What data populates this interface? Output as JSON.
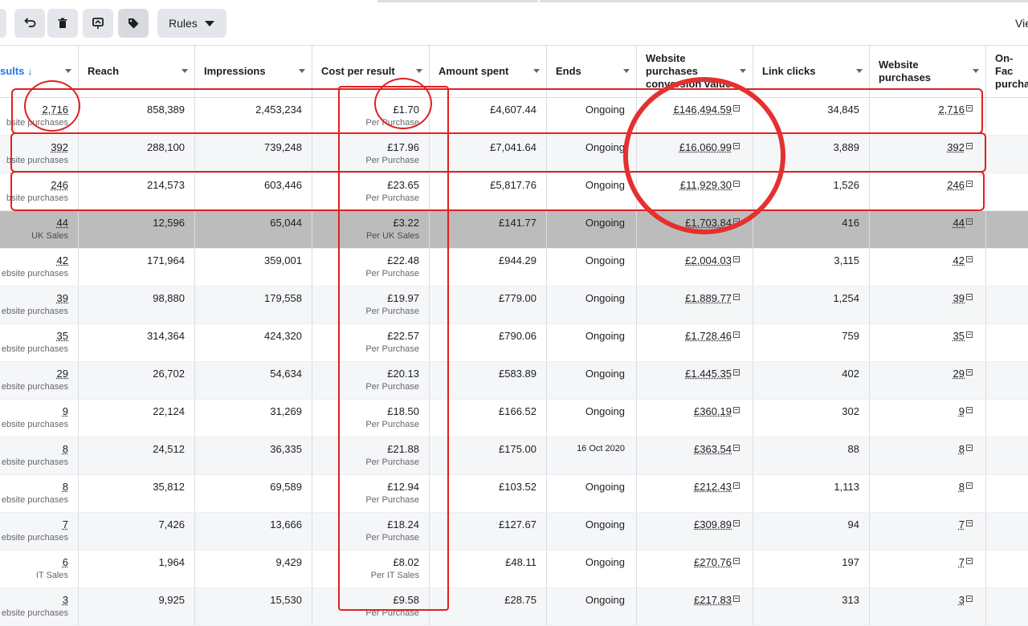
{
  "toolbar": {
    "rules_label": "Rules",
    "view_label": "Vie",
    "icons": [
      "undo-icon",
      "trash-icon",
      "preview-icon",
      "tag-icon"
    ]
  },
  "table": {
    "columns": [
      {
        "key": "results",
        "label": "sults ↓"
      },
      {
        "key": "reach",
        "label": "Reach"
      },
      {
        "key": "impressions",
        "label": "Impressions"
      },
      {
        "key": "cpr",
        "label": "Cost per result"
      },
      {
        "key": "amount",
        "label": "Amount spent"
      },
      {
        "key": "ends",
        "label": "Ends"
      },
      {
        "key": "wpcv",
        "label": "Website purchases conversion value"
      },
      {
        "key": "clicks",
        "label": "Link clicks"
      },
      {
        "key": "wp",
        "label": "Website purchases"
      },
      {
        "key": "onfb",
        "label": "On-Fac purcha"
      }
    ],
    "rows": [
      {
        "results": "2,716",
        "results_sub": "bsite purchases",
        "reach": "858,389",
        "impressions": "2,453,234",
        "cpr": "£1.70",
        "cpr_sub": "Per Purchase",
        "amount": "£4,607.44",
        "ends": "Ongoing",
        "wpcv": "£146,494.59",
        "clicks": "34,845",
        "wp": "2,716"
      },
      {
        "results": "392",
        "results_sub": "bsite purchases",
        "reach": "288,100",
        "impressions": "739,248",
        "cpr": "£17.96",
        "cpr_sub": "Per Purchase",
        "amount": "£7,041.64",
        "ends": "Ongoing",
        "wpcv": "£16,060.99",
        "clicks": "3,889",
        "wp": "392"
      },
      {
        "results": "246",
        "results_sub": "bsite purchases",
        "reach": "214,573",
        "impressions": "603,446",
        "cpr": "£23.65",
        "cpr_sub": "Per Purchase",
        "amount": "£5,817.76",
        "ends": "Ongoing",
        "wpcv": "£11,929.30",
        "clicks": "1,526",
        "wp": "246"
      },
      {
        "results": "44",
        "results_sub": "UK Sales",
        "reach": "12,596",
        "impressions": "65,044",
        "cpr": "£3.22",
        "cpr_sub": "Per UK Sales",
        "amount": "£141.77",
        "ends": "Ongoing",
        "wpcv": "£1,703.84",
        "clicks": "416",
        "wp": "44"
      },
      {
        "results": "42",
        "results_sub": "ebsite purchases",
        "reach": "171,964",
        "impressions": "359,001",
        "cpr": "£22.48",
        "cpr_sub": "Per Purchase",
        "amount": "£944.29",
        "ends": "Ongoing",
        "wpcv": "£2,004.03",
        "clicks": "3,115",
        "wp": "42"
      },
      {
        "results": "39",
        "results_sub": "ebsite purchases",
        "reach": "98,880",
        "impressions": "179,558",
        "cpr": "£19.97",
        "cpr_sub": "Per Purchase",
        "amount": "£779.00",
        "ends": "Ongoing",
        "wpcv": "£1,889.77",
        "clicks": "1,254",
        "wp": "39"
      },
      {
        "results": "35",
        "results_sub": "ebsite purchases",
        "reach": "314,364",
        "impressions": "424,320",
        "cpr": "£22.57",
        "cpr_sub": "Per Purchase",
        "amount": "£790.06",
        "ends": "Ongoing",
        "wpcv": "£1,728.46",
        "clicks": "759",
        "wp": "35"
      },
      {
        "results": "29",
        "results_sub": "ebsite purchases",
        "reach": "26,702",
        "impressions": "54,634",
        "cpr": "£20.13",
        "cpr_sub": "Per Purchase",
        "amount": "£583.89",
        "ends": "Ongoing",
        "wpcv": "£1,445.35",
        "clicks": "402",
        "wp": "29"
      },
      {
        "results": "9",
        "results_sub": "ebsite purchases",
        "reach": "22,124",
        "impressions": "31,269",
        "cpr": "£18.50",
        "cpr_sub": "Per Purchase",
        "amount": "£166.52",
        "ends": "Ongoing",
        "wpcv": "£360.19",
        "clicks": "302",
        "wp": "9"
      },
      {
        "results": "8",
        "results_sub": "ebsite purchases",
        "reach": "24,512",
        "impressions": "36,335",
        "cpr": "£21.88",
        "cpr_sub": "Per Purchase",
        "amount": "£175.00",
        "ends": "16 Oct 2020",
        "wpcv": "£363.54",
        "clicks": "88",
        "wp": "8"
      },
      {
        "results": "8",
        "results_sub": "ebsite purchases",
        "reach": "35,812",
        "impressions": "69,589",
        "cpr": "£12.94",
        "cpr_sub": "Per Purchase",
        "amount": "£103.52",
        "ends": "Ongoing",
        "wpcv": "£212.43",
        "clicks": "1,113",
        "wp": "8"
      },
      {
        "results": "7",
        "results_sub": "ebsite purchases",
        "reach": "7,426",
        "impressions": "13,666",
        "cpr": "£18.24",
        "cpr_sub": "Per Purchase",
        "amount": "£127.67",
        "ends": "Ongoing",
        "wpcv": "£309.89",
        "clicks": "94",
        "wp": "7"
      },
      {
        "results": "6",
        "results_sub": "IT Sales",
        "reach": "1,964",
        "impressions": "9,429",
        "cpr": "£8.02",
        "cpr_sub": "Per IT Sales",
        "amount": "£48.11",
        "ends": "Ongoing",
        "wpcv": "£270.76",
        "clicks": "197",
        "wp": "7"
      },
      {
        "results": "3",
        "results_sub": "ebsite purchases",
        "reach": "9,925",
        "impressions": "15,530",
        "cpr": "£9.58",
        "cpr_sub": "Per Purchase",
        "amount": "£28.75",
        "ends": "Ongoing",
        "wpcv": "£217.83",
        "clicks": "313",
        "wp": "3"
      }
    ]
  },
  "colors": {
    "annotation_red": "#e02020",
    "accent_blue": "#1877f2",
    "selected_row": "#bcbcbc",
    "alt_row": "#f5f6f7"
  }
}
